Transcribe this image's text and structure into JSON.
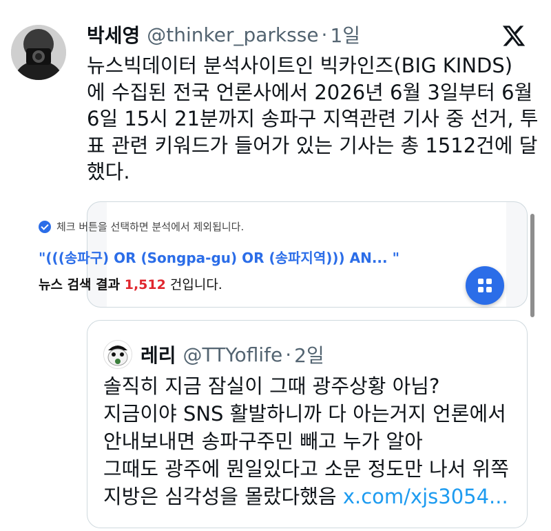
{
  "tweet": {
    "author_name": "박세영",
    "handle": "@thinker_parksse",
    "separator": "·",
    "time": "1일",
    "text_lines": [
      "뉴스빅데이터 분석사이트인 빅카인즈(BIG KINDS)",
      "에 수집된 전국 언론사에서 2026년 6월 3일부터 6월",
      "6일 15시 21분까지 송파구 지역관련 기사 중 선거, 투",
      "표 관련 키워드가 들어가 있는 기사는 총 1512건에 달",
      "했다."
    ],
    "icons": {
      "avatar": "profile-photo",
      "platform": "x-logo-icon"
    }
  },
  "image_card": {
    "notice": "체크 버튼을 선택하면 분석에서 제외됩니다.",
    "query": "\"(((송파구) OR (Songpa-gu) OR (송파지역))) AN...  \"",
    "result_prefix": "뉴스 검색 결과 ",
    "result_count": "1,512",
    "result_suffix": " 건입니다.",
    "accent_color": "#2b6de8",
    "count_color": "#e0262e"
  },
  "quote": {
    "author_name": "레리",
    "handle": "@TTYoflife",
    "separator": "·",
    "time": "2일",
    "lines": [
      "솔직히 지금 잠실이 그때 광주상황 아님?",
      "지금이야 SNS 활발하니까 다 아는거지 언론에서",
      "안내보내면 송파구주민 빼고 누가 알아",
      "그때도 광주에 뭔일있다고 소문 정도만 나서 위쪽"
    ],
    "last_line_text": "지방은 심각성을 몰랐다했음 ",
    "link": "x.com/xjs3054..."
  }
}
